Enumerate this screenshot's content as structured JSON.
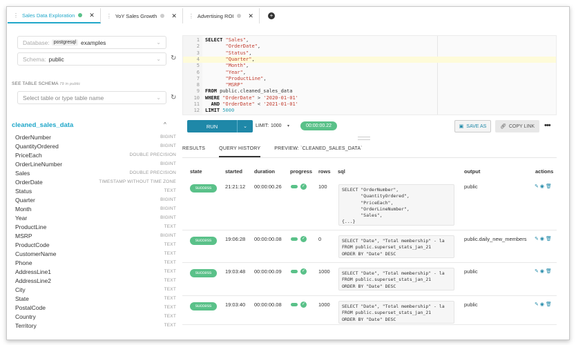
{
  "tabs": [
    {
      "label": "Sales Data Exploration",
      "active": true,
      "status": "success"
    },
    {
      "label": "YoY Sales Growth",
      "active": false,
      "status": "idle"
    },
    {
      "label": "Advertising ROI",
      "active": false,
      "status": "idle"
    }
  ],
  "left": {
    "database_label": "Database:",
    "database_engine": "postgresql",
    "database_name": "examples",
    "schema_label": "Schema:",
    "schema_value": "public",
    "schema_section": "SEE TABLE SCHEMA",
    "schema_section_sub": "79 in public",
    "table_placeholder": "Select table or type table name",
    "table_name": "cleaned_sales_data",
    "columns": [
      {
        "name": "OrderNumber",
        "type": "BIGINT"
      },
      {
        "name": "QuantityOrdered",
        "type": "BIGINT"
      },
      {
        "name": "PriceEach",
        "type": "DOUBLE PRECISION"
      },
      {
        "name": "OrderLineNumber",
        "type": "BIGINT"
      },
      {
        "name": "Sales",
        "type": "DOUBLE PRECISION"
      },
      {
        "name": "OrderDate",
        "type": "TIMESTAMP WITHOUT TIME ZONE"
      },
      {
        "name": "Status",
        "type": "TEXT"
      },
      {
        "name": "Quarter",
        "type": "BIGINT"
      },
      {
        "name": "Month",
        "type": "BIGINT"
      },
      {
        "name": "Year",
        "type": "BIGINT"
      },
      {
        "name": "ProductLine",
        "type": "TEXT"
      },
      {
        "name": "MSRP",
        "type": "BIGINT"
      },
      {
        "name": "ProductCode",
        "type": "TEXT"
      },
      {
        "name": "CustomerName",
        "type": "TEXT"
      },
      {
        "name": "Phone",
        "type": "TEXT"
      },
      {
        "name": "AddressLine1",
        "type": "TEXT"
      },
      {
        "name": "AddressLine2",
        "type": "TEXT"
      },
      {
        "name": "City",
        "type": "TEXT"
      },
      {
        "name": "State",
        "type": "TEXT"
      },
      {
        "name": "PostalCode",
        "type": "TEXT"
      },
      {
        "name": "Country",
        "type": "TEXT"
      },
      {
        "name": "Territory",
        "type": "TEXT"
      }
    ]
  },
  "editor": {
    "lines": [
      {
        "n": "1",
        "parts": [
          [
            "kw",
            "SELECT "
          ],
          [
            "str",
            "\"Sales\""
          ],
          [
            "",
            ","
          ]
        ]
      },
      {
        "n": "2",
        "parts": [
          [
            "",
            "       "
          ],
          [
            "str",
            "\"OrderDate\""
          ],
          [
            "",
            ","
          ]
        ]
      },
      {
        "n": "3",
        "parts": [
          [
            "",
            "       "
          ],
          [
            "str",
            "\"Status\""
          ],
          [
            "",
            ","
          ]
        ]
      },
      {
        "n": "4",
        "parts": [
          [
            "",
            "       "
          ],
          [
            "str",
            "\"Quarter\""
          ],
          [
            "",
            ","
          ]
        ],
        "highlight": true
      },
      {
        "n": "5",
        "parts": [
          [
            "",
            "       "
          ],
          [
            "str",
            "\"Month\""
          ],
          [
            "",
            ","
          ]
        ]
      },
      {
        "n": "6",
        "parts": [
          [
            "",
            "       "
          ],
          [
            "str",
            "\"Year\""
          ],
          [
            "",
            ","
          ]
        ]
      },
      {
        "n": "7",
        "parts": [
          [
            "",
            "       "
          ],
          [
            "str",
            "\"ProductLine\""
          ],
          [
            "",
            ","
          ]
        ]
      },
      {
        "n": "8",
        "parts": [
          [
            "",
            "       "
          ],
          [
            "str",
            "\"MSRP\""
          ]
        ]
      },
      {
        "n": "9",
        "parts": [
          [
            "kw",
            "FROM "
          ],
          [
            "",
            "public.cleaned_sales_data"
          ]
        ]
      },
      {
        "n": "10",
        "parts": [
          [
            "kw",
            "WHERE "
          ],
          [
            "str",
            "\"OrderDate\""
          ],
          [
            "",
            " > "
          ],
          [
            "str",
            "'2020-01-01'"
          ]
        ]
      },
      {
        "n": "11",
        "parts": [
          [
            "",
            "  "
          ],
          [
            "kw",
            "AND "
          ],
          [
            "str",
            "\"OrderDate\""
          ],
          [
            "",
            " < "
          ],
          [
            "str",
            "'2021-01-01'"
          ]
        ]
      },
      {
        "n": "12",
        "parts": [
          [
            "kw",
            "LIMIT "
          ],
          [
            "num",
            "5000"
          ]
        ]
      }
    ]
  },
  "toolbar": {
    "run_label": "RUN",
    "limit_label": "LIMIT:",
    "limit_value": "1000",
    "timer": "00:00:00.22",
    "save_label": "SAVE AS",
    "copy_label": "COPY LINK"
  },
  "result_tabs": [
    "RESULTS",
    "QUERY HISTORY",
    "PREVIEW: `CLEANED_SALES_DATA`"
  ],
  "history": {
    "headers": [
      "state",
      "started",
      "duration",
      "progress",
      "rows",
      "sql",
      "output",
      "actions"
    ],
    "rows": [
      {
        "state": "success",
        "started": "21:21:12",
        "duration": "00:00:00.26",
        "rows": "100",
        "sql": "SELECT \"OrderNumber\",\n       \"QuantityOrdered\",\n       \"PriceEach\",\n       \"OrderLineNumber\",\n       \"Sales\",\n{...}",
        "output": "public"
      },
      {
        "state": "success",
        "started": "19:06:28",
        "duration": "00:00:00.08",
        "rows": "0",
        "sql": "SELECT \"Date\", \"Total membership\" - la\nFROM public.superset_stats_jan_21\nORDER BY \"Date\" DESC",
        "output": "public.daily_new_members"
      },
      {
        "state": "success",
        "started": "19:03:48",
        "duration": "00:00:00.09",
        "rows": "1000",
        "sql": "SELECT \"Date\", \"Total membership\" - la\nFROM public.superset_stats_jan_21\nORDER BY \"Date\" DESC",
        "output": "public"
      },
      {
        "state": "success",
        "started": "19:03:40",
        "duration": "00:00:00.08",
        "rows": "1000",
        "sql": "SELECT \"Date\", \"Total membership\" - la\nFROM public.superset_stats_jan_21\nORDER BY \"Date\" DESC",
        "output": "public"
      }
    ]
  },
  "colors": {
    "accent": "#20a7c9",
    "success": "#5ac189",
    "run": "#1f88a8"
  }
}
